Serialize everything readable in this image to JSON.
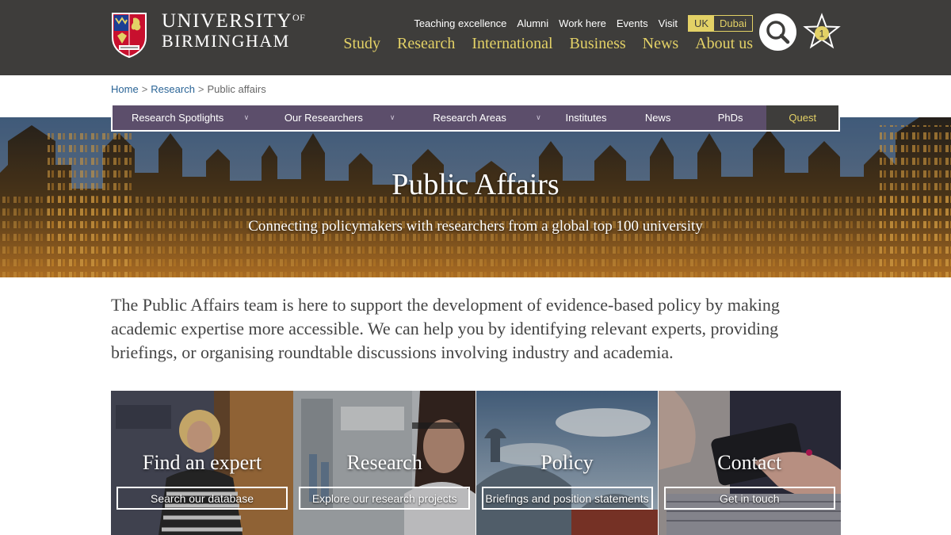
{
  "brand": {
    "line1": "UNIVERSITY",
    "of": "OF",
    "line2": "BIRMINGHAM"
  },
  "utility_nav": [
    "Teaching excellence",
    "Alumni",
    "Work here",
    "Events",
    "Visit"
  ],
  "language": {
    "uk": "UK",
    "dubai": "Dubai"
  },
  "main_nav": [
    "Study",
    "Research",
    "International",
    "Business",
    "News",
    "About us"
  ],
  "shortlist_count": "1",
  "breadcrumb": {
    "home": "Home",
    "research": "Research",
    "current": "Public affairs",
    "sep": ">"
  },
  "sub_nav": {
    "items": [
      "Research Spotlights",
      "Our Researchers",
      "Research Areas",
      "Institutes",
      "News",
      "PhDs"
    ],
    "quest": "Quest"
  },
  "hero": {
    "title": "Public Affairs",
    "subtitle": "Connecting policymakers with researchers from a global top 100 university"
  },
  "intro": "The Public Affairs team is here to support the development of evidence-based policy by making academic expertise more accessible. We can help you by identifying relevant experts, providing briefings, or organising roundtable discussions involving industry and academia.",
  "cards": [
    {
      "title": "Find an expert",
      "button": "Search our database"
    },
    {
      "title": "Research",
      "button": "Explore our research projects"
    },
    {
      "title": "Policy",
      "button": "Briefings and position statements"
    },
    {
      "title": "Contact",
      "button": "Get in touch"
    }
  ],
  "colors": {
    "header_bg": "#3e3d3b",
    "gold": "#e3d166",
    "subnav_purple": "#5c4e6b",
    "link_blue": "#2a6496"
  }
}
